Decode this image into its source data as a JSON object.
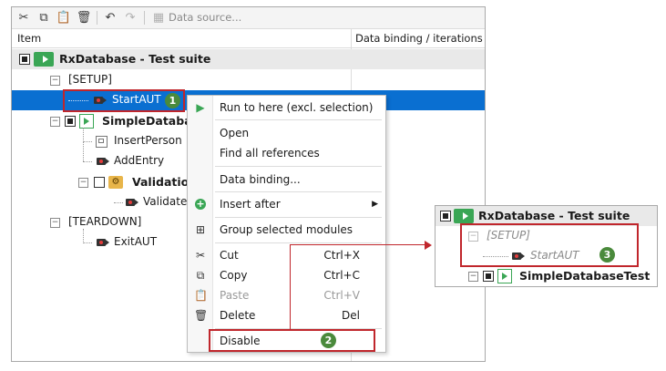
{
  "toolbar": {
    "icons": [
      "scissors-icon",
      "copy-icon",
      "paste-icon",
      "trash-icon",
      "undo-icon",
      "redo-icon",
      "data-source-icon"
    ],
    "data_source_label": "Data source..."
  },
  "table": {
    "col_item": "Item",
    "col_binding": "Data binding / iterations"
  },
  "tree": {
    "root": "RxDatabase - Test suite",
    "setup": "[SETUP]",
    "start_aut": "StartAUT",
    "simple_db_test": "SimpleDatabase",
    "insert_person": "InsertPerson",
    "add_entry": "AddEntry",
    "validation": "Validation",
    "validate": "ValidateE",
    "teardown": "[TEARDOWN]",
    "exit_aut": "ExitAUT"
  },
  "context_menu": {
    "items": [
      {
        "label": "Run to here (excl. selection)"
      },
      {
        "label": "Open"
      },
      {
        "label": "Find all references"
      },
      {
        "label": "Data binding..."
      },
      {
        "label": "Insert after"
      },
      {
        "label": "Group selected modules"
      },
      {
        "label": "Cut",
        "shortcut": "Ctrl+X"
      },
      {
        "label": "Copy",
        "shortcut": "Ctrl+C"
      },
      {
        "label": "Paste",
        "shortcut": "Ctrl+V"
      },
      {
        "label": "Delete",
        "shortcut": "Del"
      },
      {
        "label": "Disable"
      }
    ]
  },
  "inset": {
    "root": "RxDatabase - Test suite",
    "setup": "[SETUP]",
    "start_aut": "StartAUT",
    "simple_db_test": "SimpleDatabaseTest"
  },
  "badges": {
    "one": "1",
    "two": "2",
    "three": "3"
  },
  "colors": {
    "selection": "#0a6fd1",
    "accent_red": "#c0262c",
    "badge_green": "#4a8a3c"
  }
}
